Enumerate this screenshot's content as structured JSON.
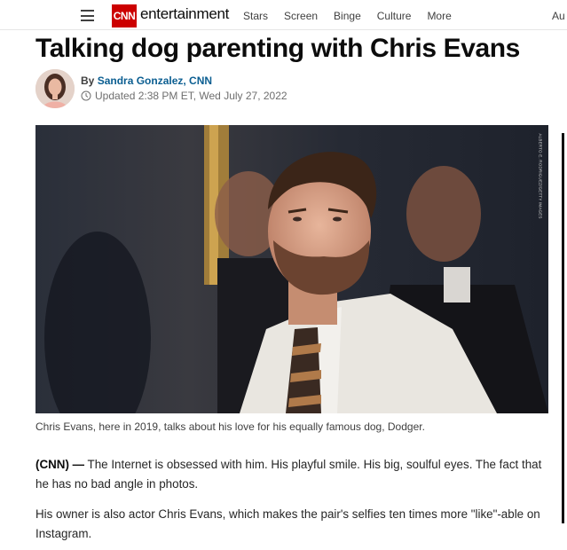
{
  "nav": {
    "logo": "CNN",
    "section": "entertainment",
    "links": [
      "Stars",
      "Screen",
      "Binge",
      "Culture",
      "More"
    ],
    "cut_link": "Au"
  },
  "article": {
    "headline": "Talking dog parenting with Chris Evans",
    "byline_prefix": "By",
    "author": "Sandra Gonzalez, CNN",
    "updated": "Updated 2:38 PM ET, Wed July 27, 2022",
    "image_credit": "ALBERTO E. RODRIGUEZ/GETTY IMAGES",
    "caption": "Chris Evans, here in 2019, talks about his love for his equally famous dog, Dodger.",
    "para1_lead": "(CNN) —",
    "para1_text": " The Internet is obsessed with him. His playful smile. His big, soulful eyes. The fact that he has no bad angle in photos.",
    "para2_text": "His owner is also actor Chris Evans, which makes the pair's selfies ten times more \"like\"-able on Instagram."
  },
  "colors": {
    "brand": "#cc0000",
    "author_link": "#0b5e91"
  }
}
